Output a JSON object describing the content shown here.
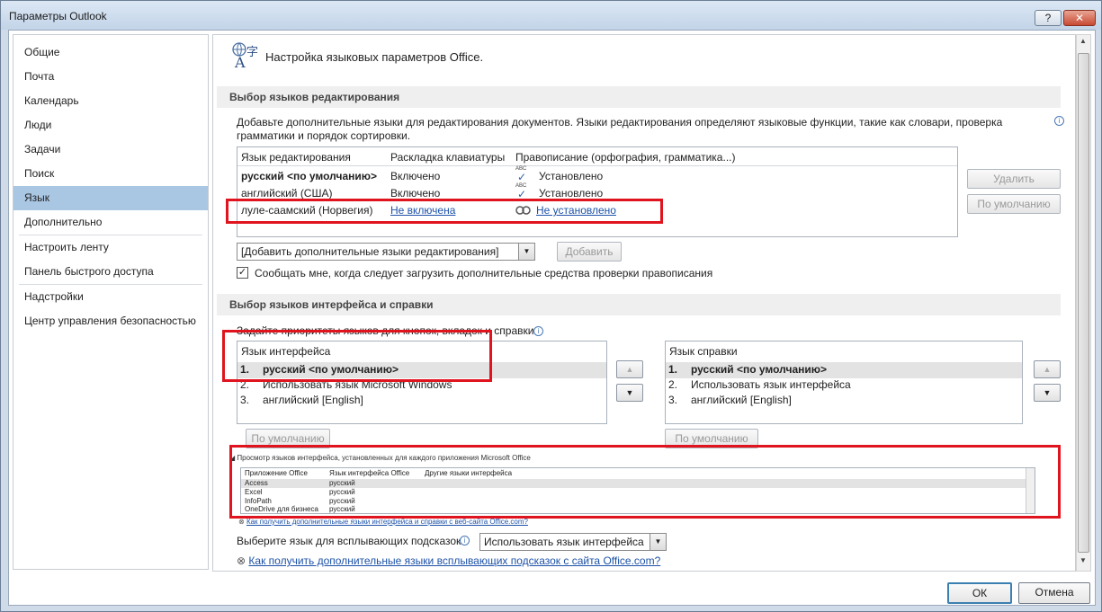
{
  "window": {
    "title": "Параметры Outlook",
    "help_label": "?",
    "close_label": "✕"
  },
  "sidebar": {
    "items": [
      {
        "label": "Общие"
      },
      {
        "label": "Почта"
      },
      {
        "label": "Календарь"
      },
      {
        "label": "Люди"
      },
      {
        "label": "Задачи"
      },
      {
        "label": "Поиск"
      },
      {
        "label": "Язык"
      },
      {
        "label": "Дополнительно"
      },
      {
        "label": "Настроить ленту"
      },
      {
        "label": "Панель быстрого доступа"
      },
      {
        "label": "Надстройки"
      },
      {
        "label": "Центр управления безопасностью"
      }
    ],
    "active": "Язык"
  },
  "header": {
    "title": "Настройка языковых параметров Office."
  },
  "editing": {
    "section_title": "Выбор языков редактирования",
    "description_line1": "Добавьте дополнительные языки для редактирования документов. Языки редактирования определяют языковые функции, такие как словари, проверка",
    "description_line2": "грамматики и порядок сортировки.",
    "columns": [
      "Язык редактирования",
      "Раскладка клавиатуры",
      "Правописание (орфография, грамматика...)"
    ],
    "rows": [
      {
        "language": "русский <по умолчанию>",
        "keyboard": "Включено",
        "proofing": "Установлено"
      },
      {
        "language": "английский (США)",
        "keyboard": "Включено",
        "proofing": "Установлено"
      },
      {
        "language": "луле-саамский (Норвегия)",
        "keyboard": "Не включена",
        "proofing": "Не установлено"
      }
    ],
    "delete_button": "Удалить",
    "default_button": "По умолчанию",
    "add_combo_value": "[Добавить дополнительные языки редактирования]",
    "add_button": "Добавить",
    "notify_checkbox_label": "Сообщать мне, когда следует загрузить дополнительные средства проверки правописания",
    "abc_glyph": "ABC"
  },
  "ui": {
    "section_title": "Выбор языков интерфейса и справки",
    "priority_label": "Задайте приоритеты языков для кнопок, вкладок и справки",
    "interface_header": "Язык интерфейса",
    "interface_items": [
      {
        "num": "1.",
        "label": "русский <по умолчанию>"
      },
      {
        "num": "2.",
        "label": "Использовать язык Microsoft Windows"
      },
      {
        "num": "3.",
        "label": "английский [English]"
      }
    ],
    "help_header": "Язык справки",
    "help_items": [
      {
        "num": "1.",
        "label": "русский <по умолчанию>"
      },
      {
        "num": "2.",
        "label": "Использовать язык интерфейса"
      },
      {
        "num": "3.",
        "label": "английский [English]"
      }
    ],
    "default_button_left": "По умолчанию",
    "default_button_right": "По умолчанию",
    "view_expander": "Просмотр языков интерфейса, установленных для каждого приложения Microsoft Office",
    "app_columns": [
      "Приложение Office",
      "Язык интерфейса Office",
      "Другие языки интерфейса"
    ],
    "apps": [
      {
        "app": "Access",
        "lang": "русский"
      },
      {
        "app": "Excel",
        "lang": "русский"
      },
      {
        "app": "InfoPath",
        "lang": "русский"
      },
      {
        "app": "OneDrive для бизнеса",
        "lang": "русский"
      }
    ],
    "get_ui_link": "Как получить дополнительные языки интерфейса и справки с веб-сайта Office.com?"
  },
  "screentip": {
    "label": "Выберите язык для всплывающих подсказок",
    "value": "Использовать язык интерфейса",
    "link": "Как получить дополнительные языки всплывающих подсказок с сайта Office.com?"
  },
  "footer": {
    "ok": "ОК",
    "cancel": "Отмена"
  },
  "colors": {
    "highlight": "#e0141e",
    "accent": "#a9c6e3",
    "link": "#1d52a8"
  }
}
